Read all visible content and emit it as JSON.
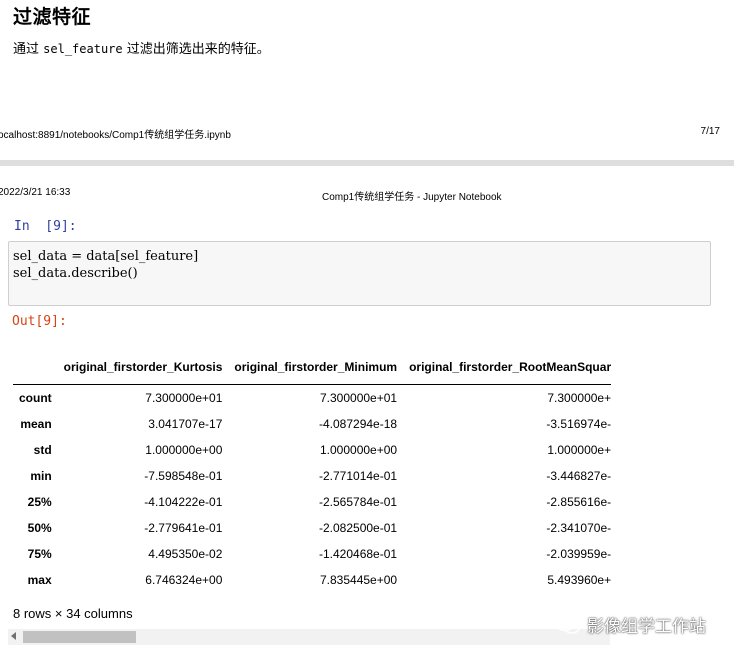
{
  "section": {
    "heading": "过滤特征",
    "intro_prefix": "通过 ",
    "intro_code": "sel_feature",
    "intro_suffix": " 过滤出筛选出来的特征。"
  },
  "print_footer": {
    "url": "ocalhost:8891/notebooks/Comp1传统组学任务.ipynb",
    "page": "7/17"
  },
  "print_header": {
    "datetime": "2022/3/21 16:33",
    "title": "Comp1传统组学任务 - Jupyter Notebook"
  },
  "cell": {
    "in_prompt": "In  [9]:",
    "code": [
      "sel_data = data[sel_feature]",
      "sel_data.describe()"
    ],
    "out_prompt": "Out[9]:"
  },
  "table": {
    "columns": [
      "original_firstorder_Kurtosis",
      "original_firstorder_Minimum",
      "original_firstorder_RootMeanSquar"
    ],
    "rows": [
      {
        "label": "count",
        "values": [
          "7.300000e+01",
          "7.300000e+01",
          "7.300000e+"
        ]
      },
      {
        "label": "mean",
        "values": [
          "3.041707e-17",
          "-4.087294e-18",
          "-3.516974e-"
        ]
      },
      {
        "label": "std",
        "values": [
          "1.000000e+00",
          "1.000000e+00",
          "1.000000e+"
        ]
      },
      {
        "label": "min",
        "values": [
          "-7.598548e-01",
          "-2.771014e-01",
          "-3.446827e-"
        ]
      },
      {
        "label": "25%",
        "values": [
          "-4.104222e-01",
          "-2.565784e-01",
          "-2.855616e-"
        ]
      },
      {
        "label": "50%",
        "values": [
          "-2.779641e-01",
          "-2.082500e-01",
          "-2.341070e-"
        ]
      },
      {
        "label": "75%",
        "values": [
          "4.495350e-02",
          "-1.420468e-01",
          "-2.039959e-"
        ]
      },
      {
        "label": "max",
        "values": [
          "6.746324e+00",
          "7.835445e+00",
          "5.493960e+"
        ]
      }
    ],
    "summary": "8 rows × 34 columns"
  },
  "watermark": {
    "text": "影像组学工作站",
    "icon": "wechat-icon"
  },
  "colors": {
    "in_prompt": "#303f9f",
    "out_prompt": "#d84315",
    "cell_background": "#f7f7f7",
    "cell_border": "#cfcfcf"
  }
}
